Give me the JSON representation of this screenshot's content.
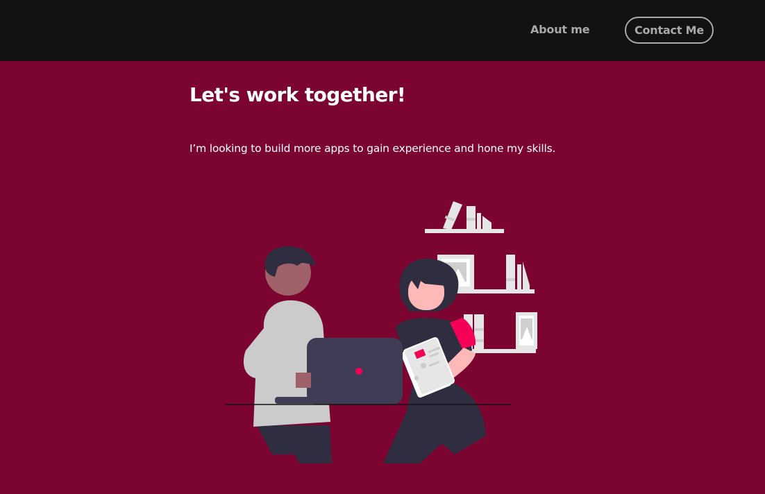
{
  "nav": {
    "about_label": "About me",
    "contact_label": "Contact Me"
  },
  "hero": {
    "heading": "Let's work together!",
    "subtext": "I’m looking to build more apps to gain experience and hone my skills."
  },
  "illustration": {
    "icon": "collaboration-illustration"
  },
  "colors": {
    "topbar": "#141111",
    "background": "#7b0530",
    "nav_text": "#a9a9a9",
    "accent": "#f50057"
  }
}
